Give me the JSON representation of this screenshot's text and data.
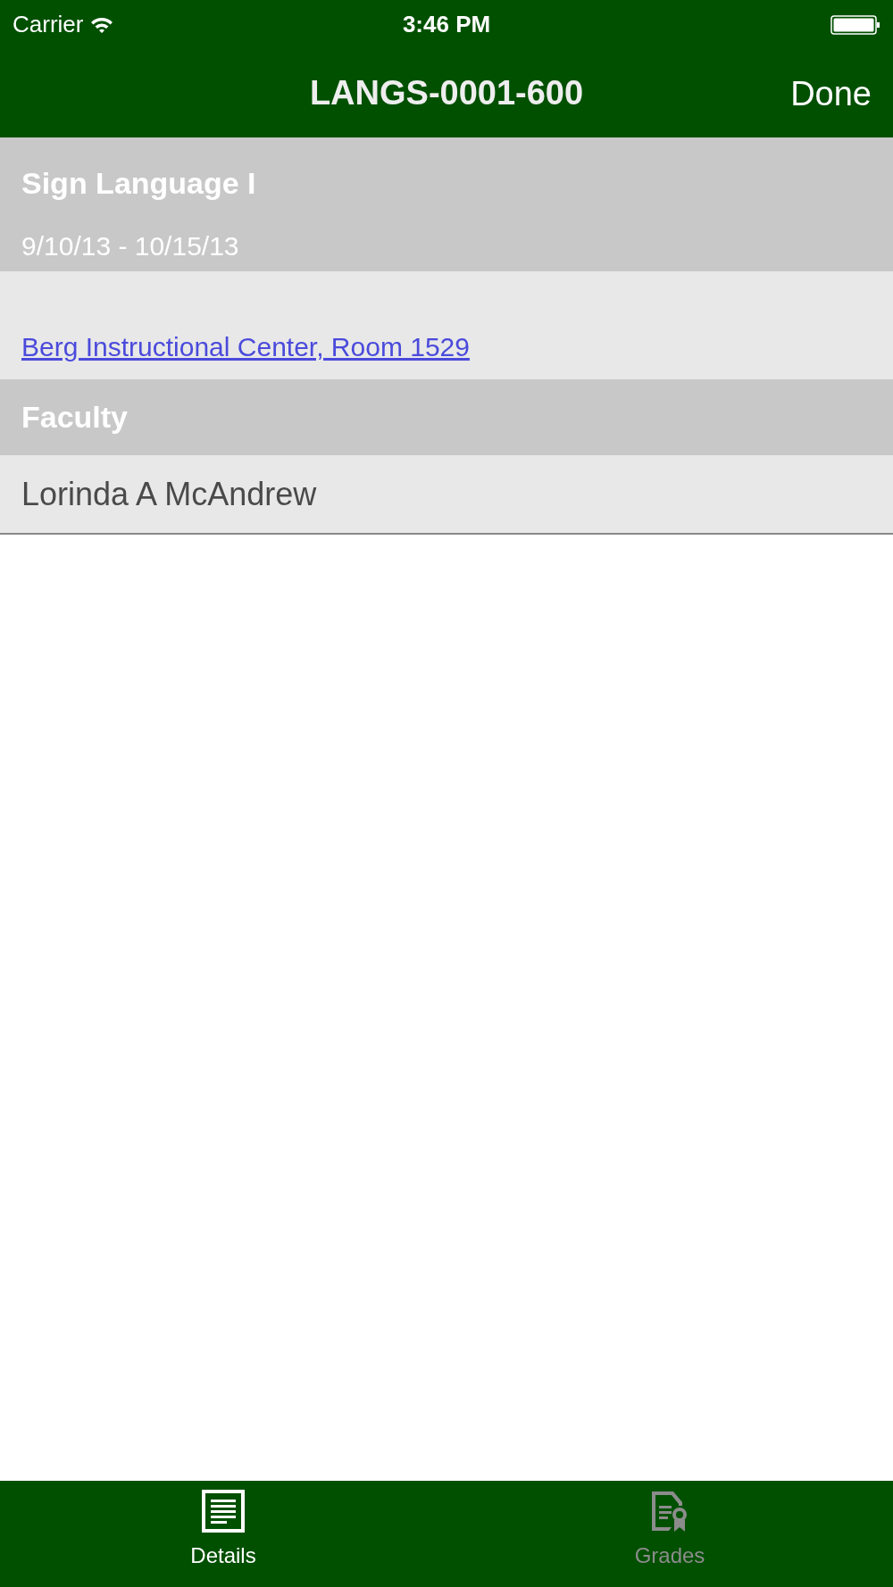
{
  "status_bar": {
    "carrier": "Carrier",
    "time": "3:46 PM"
  },
  "nav_bar": {
    "title": "LANGS-0001-600",
    "done_button": "Done"
  },
  "course": {
    "title": "Sign Language I",
    "dates": "9/10/13 - 10/15/13"
  },
  "location": {
    "link": "Berg Instructional Center, Room 1529"
  },
  "sections": [
    {
      "header": "Faculty",
      "rows": [
        "Lorinda A McAndrew"
      ]
    }
  ],
  "tabs": [
    {
      "label": "Details",
      "kind": "details",
      "selected": true
    },
    {
      "label": "Grades",
      "kind": "grades",
      "selected": false
    }
  ]
}
